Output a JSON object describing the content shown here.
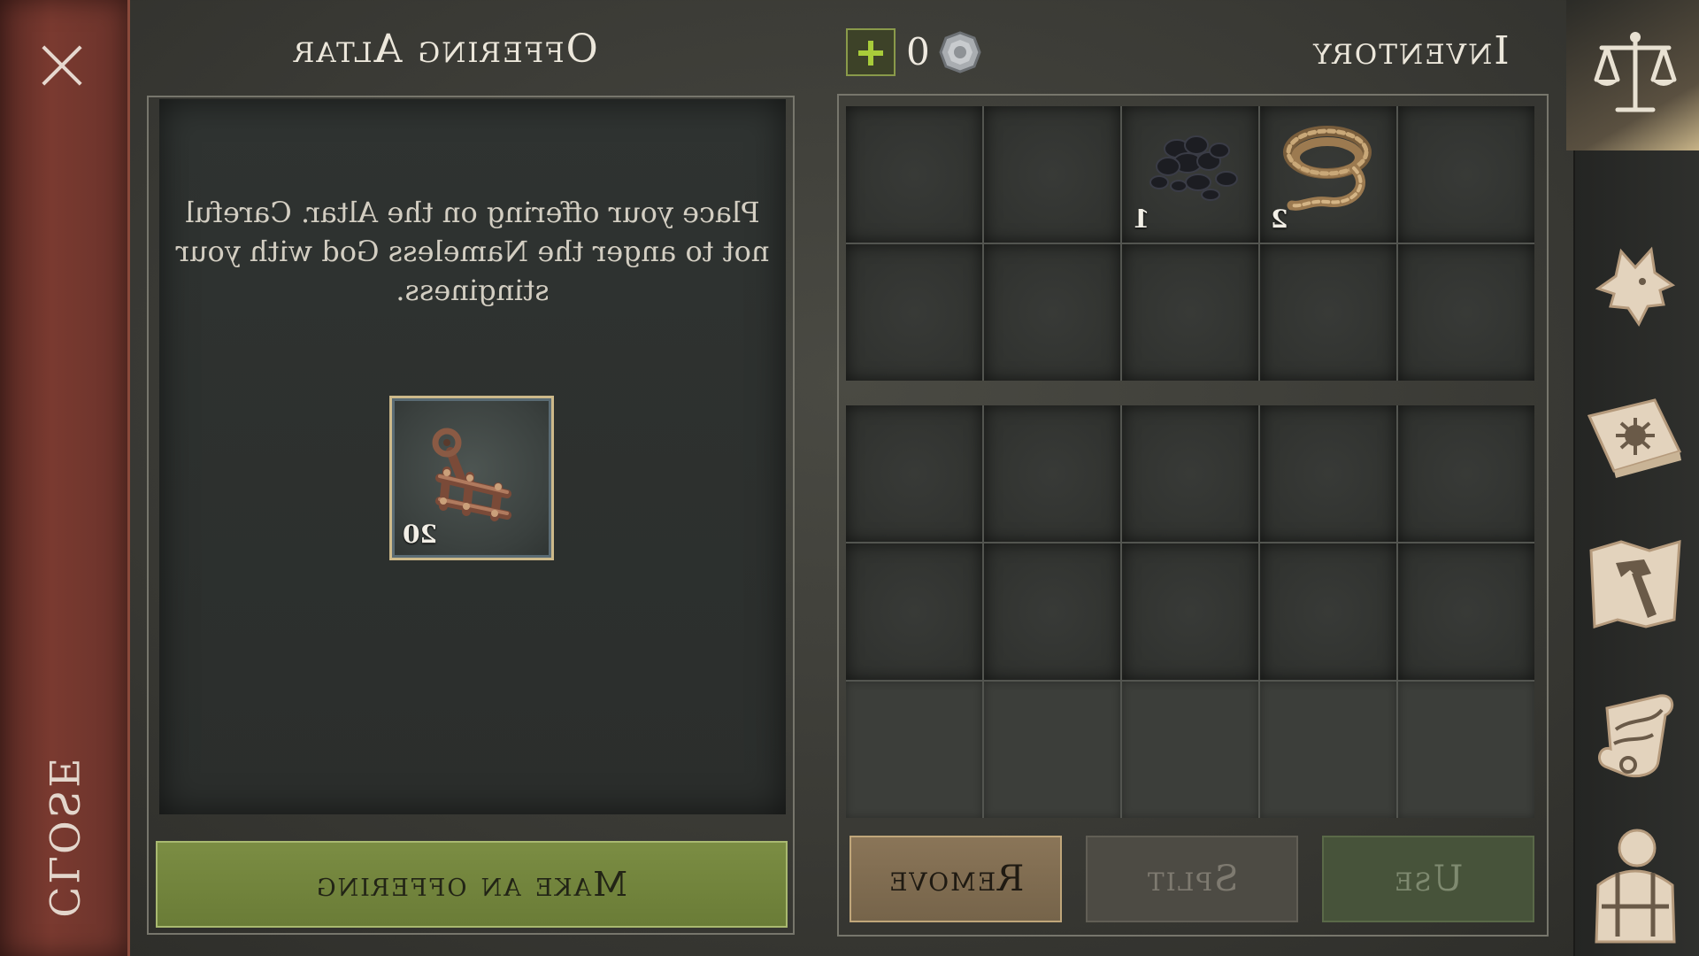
{
  "close_bar": {
    "label": "CLOSE",
    "x_icon": "close-icon"
  },
  "altar": {
    "title": "Offering Altar",
    "description_lines": [
      "Place your offering on the Altar. Careful",
      "not to anger the Nameless God with your",
      "stinginess."
    ],
    "offering_item": {
      "icon": "crossbow-frame-icon",
      "count": "20"
    },
    "make_offering_label": "Make an offering"
  },
  "currency": {
    "count": "0",
    "coin_icon": "silver-coin-icon",
    "add_icon": "plus-icon"
  },
  "inventory": {
    "title": "Inventory",
    "top_grid": [
      {
        "icon": "",
        "count": ""
      },
      {
        "icon": "",
        "count": ""
      },
      {
        "icon": "coal-icon",
        "count": "1"
      },
      {
        "icon": "rope-icon",
        "count": "2"
      },
      {
        "icon": "",
        "count": ""
      },
      {
        "icon": "",
        "count": ""
      },
      {
        "icon": "",
        "count": ""
      },
      {
        "icon": "",
        "count": ""
      },
      {
        "icon": "",
        "count": ""
      },
      {
        "icon": "",
        "count": ""
      }
    ],
    "buttons": {
      "remove": "Remove",
      "split": "Split",
      "use": "Use"
    }
  },
  "side_bar": [
    {
      "icon": "scales-icon"
    },
    {
      "icon": "wolf-head-icon"
    },
    {
      "icon": "sun-book-icon"
    },
    {
      "icon": "hammer-map-icon"
    },
    {
      "icon": "scroll-quill-icon"
    },
    {
      "icon": "character-backpack-icon"
    }
  ],
  "colors": {
    "close_bar": "#6a332b",
    "offer_button": "#6f8139",
    "remove_button": "#7f6b50",
    "panel": "#2f3331"
  }
}
